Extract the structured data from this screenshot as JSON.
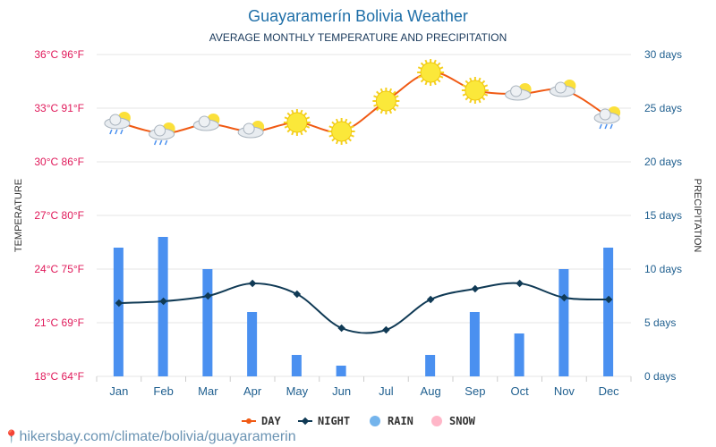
{
  "title": "Guayaramerín Bolivia Weather",
  "subtitle": "AVERAGE MONTHLY TEMPERATURE AND PRECIPITATION",
  "link": "hikersbay.com/climate/bolivia/guayaramerin",
  "chart_data": {
    "type": "line+bar",
    "categories": [
      "Jan",
      "Feb",
      "Mar",
      "Apr",
      "May",
      "Jun",
      "Jul",
      "Aug",
      "Sep",
      "Oct",
      "Nov",
      "Dec"
    ],
    "left_axis": {
      "label": "TEMPERATURE",
      "range": [
        18,
        36
      ],
      "ticks": [
        "18°C 64°F",
        "21°C 69°F",
        "24°C 75°F",
        "27°C 80°F",
        "30°C 86°F",
        "33°C 91°F",
        "36°C 96°F"
      ],
      "color": "#e0195a"
    },
    "right_axis": {
      "label": "PRECIPITATION",
      "range": [
        0,
        30
      ],
      "ticks": [
        "0 days",
        "5 days",
        "10 days",
        "15 days",
        "20 days",
        "25 days",
        "30 days"
      ],
      "color": "#1f5f8f"
    },
    "grid": true,
    "legend_placement": "bottom",
    "series": [
      {
        "name": "DAY",
        "type": "line",
        "axis": "left",
        "color": "#f05a14",
        "values": [
          32.2,
          31.6,
          32.1,
          31.7,
          32.2,
          31.7,
          33.4,
          35.0,
          34.0,
          33.8,
          34.0,
          32.5
        ]
      },
      {
        "name": "NIGHT",
        "type": "line",
        "axis": "left",
        "color": "#103a55",
        "values": [
          22.1,
          22.2,
          22.5,
          23.2,
          22.6,
          20.7,
          20.6,
          22.3,
          22.9,
          23.2,
          22.4,
          22.3
        ]
      },
      {
        "name": "RAIN",
        "type": "bar",
        "axis": "right",
        "color": "#4a90f0",
        "values": [
          12,
          13,
          10,
          6,
          2,
          1,
          0,
          2,
          6,
          4,
          10,
          12
        ]
      },
      {
        "name": "SNOW",
        "type": "bar",
        "axis": "right",
        "color": "#ffb6c8",
        "values": [
          0,
          0,
          0,
          0,
          0,
          0,
          0,
          0,
          0,
          0,
          0,
          0
        ]
      }
    ],
    "icons": [
      "cloud-sun-rain",
      "cloud-sun-rain",
      "sun-cloud",
      "sun-cloud",
      "sun",
      "sun",
      "sun",
      "sun",
      "sun",
      "sun-cloud",
      "sun-cloud",
      "cloud-sun-rain"
    ]
  }
}
